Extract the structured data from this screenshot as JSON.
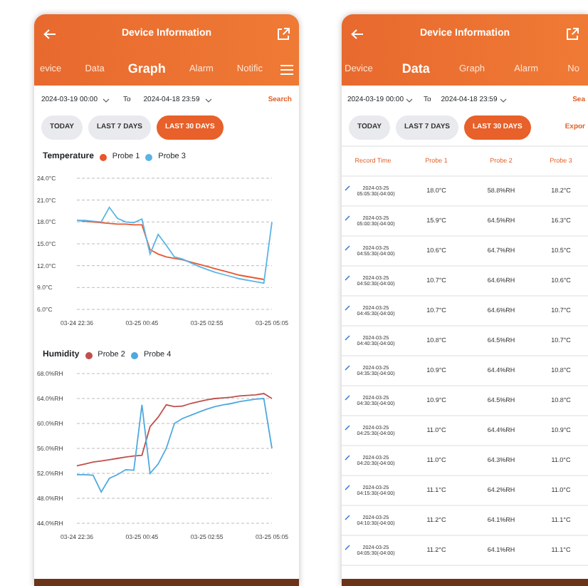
{
  "phones": [
    {
      "kind": "graph",
      "header": {
        "title": "Device Information",
        "tabs": [
          {
            "label": "evice",
            "selected": false
          },
          {
            "label": "Data",
            "selected": false
          },
          {
            "label": "Graph",
            "selected": true
          },
          {
            "label": "Alarm",
            "selected": false
          },
          {
            "label": "Notific",
            "selected": false
          }
        ]
      },
      "date_range": {
        "from": "2024-03-19 00:00",
        "to_label": "To",
        "to": "2024-04-18 23:59",
        "search": "Search"
      },
      "range_buttons": [
        {
          "label": "TODAY",
          "selected": false
        },
        {
          "label": "LAST 7 DAYS",
          "selected": false
        },
        {
          "label": "LAST 30 DAYS",
          "selected": true
        }
      ],
      "charts": [
        {
          "title": "Temperature",
          "chart_data": {
            "type": "line",
            "grid": true,
            "ylim": [
              6,
              24
            ],
            "yticks": [
              {
                "value": 24,
                "label": "24.0°C"
              },
              {
                "value": 21,
                "label": "21.0°C"
              },
              {
                "value": 18,
                "label": "18.0°C"
              },
              {
                "value": 15,
                "label": "15.0°C"
              },
              {
                "value": 12,
                "label": "12.0°C"
              },
              {
                "value": 9,
                "label": "9.0°C"
              },
              {
                "value": 6,
                "label": "6.0°C"
              }
            ],
            "categories": [
              "03-24 22:36",
              null,
              null,
              null,
              null,
              null,
              null,
              null,
              "03-25 00:45",
              null,
              null,
              null,
              null,
              null,
              null,
              null,
              "03-25 02:55",
              null,
              null,
              null,
              null,
              null,
              null,
              null,
              "03-25 05:05"
            ],
            "series": [
              {
                "name": "Probe 1",
                "color": "#e8562c",
                "values": [
                  18.2,
                  18.1,
                  18.0,
                  17.9,
                  17.8,
                  17.7,
                  17.7,
                  17.6,
                  17.6,
                  14.2,
                  13.6,
                  13.2,
                  13.0,
                  12.8,
                  12.5,
                  12.2,
                  11.9,
                  11.6,
                  11.3,
                  11.0,
                  10.7,
                  10.5,
                  10.3,
                  10.1,
                  null
                ]
              },
              {
                "name": "Probe 3",
                "color": "#5ab4e6",
                "values": [
                  18.2,
                  18.2,
                  18.1,
                  18.0,
                  20.0,
                  18.5,
                  18.0,
                  17.9,
                  18.4,
                  13.6,
                  16.3,
                  14.8,
                  13.2,
                  12.9,
                  12.4,
                  11.9,
                  11.5,
                  11.1,
                  10.8,
                  10.5,
                  10.2,
                  10.0,
                  9.8,
                  9.6,
                  18.0
                ]
              }
            ]
          }
        },
        {
          "title": "Humidity",
          "chart_data": {
            "type": "line",
            "grid": true,
            "ylim": [
              44,
              68
            ],
            "yticks": [
              {
                "value": 68,
                "label": "68.0%RH"
              },
              {
                "value": 64,
                "label": "64.0%RH"
              },
              {
                "value": 60,
                "label": "60.0%RH"
              },
              {
                "value": 56,
                "label": "56.0%RH"
              },
              {
                "value": 52,
                "label": "52.0%RH"
              },
              {
                "value": 48,
                "label": "48.0%RH"
              },
              {
                "value": 44,
                "label": "44.0%RH"
              }
            ],
            "categories": [
              "03-24 22:36",
              null,
              null,
              null,
              null,
              null,
              null,
              null,
              "03-25 00:45",
              null,
              null,
              null,
              null,
              null,
              null,
              null,
              "03-25 02:55",
              null,
              null,
              null,
              null,
              null,
              null,
              null,
              "03-25 05:05"
            ],
            "series": [
              {
                "name": "Probe 2",
                "color": "#c0504d",
                "values": [
                  53.2,
                  53.5,
                  53.8,
                  54.0,
                  54.2,
                  54.4,
                  54.6,
                  54.8,
                  54.9,
                  59.5,
                  61.0,
                  63.0,
                  62.7,
                  62.8,
                  63.2,
                  63.5,
                  63.8,
                  64.0,
                  64.1,
                  64.2,
                  64.4,
                  64.5,
                  64.6,
                  64.8,
                  64.0
                ]
              },
              {
                "name": "Probe 4",
                "color": "#4fa9e0",
                "values": [
                  51.8,
                  51.8,
                  51.7,
                  49.0,
                  51.2,
                  51.8,
                  52.6,
                  52.5,
                  63.0,
                  52.0,
                  53.5,
                  56.0,
                  60.0,
                  60.8,
                  61.3,
                  61.8,
                  62.3,
                  62.7,
                  63.0,
                  63.2,
                  63.5,
                  63.7,
                  63.9,
                  64.0,
                  56.0
                ]
              }
            ]
          }
        }
      ]
    },
    {
      "kind": "data",
      "header": {
        "title": "Device Information",
        "tabs": [
          {
            "label": "Device",
            "selected": false
          },
          {
            "label": "Data",
            "selected": true
          },
          {
            "label": "Graph",
            "selected": false
          },
          {
            "label": "Alarm",
            "selected": false
          },
          {
            "label": "No",
            "selected": false
          }
        ]
      },
      "date_range": {
        "from": "2024-03-19 00:00",
        "to_label": "To",
        "to": "2024-04-18 23:59",
        "search": "Sea"
      },
      "range_buttons": [
        {
          "label": "TODAY",
          "selected": false
        },
        {
          "label": "LAST 7 DAYS",
          "selected": false
        },
        {
          "label": "LAST 30 DAYS",
          "selected": true
        }
      ],
      "export": "Expor",
      "table": {
        "columns": [
          "Record Time",
          "Probe 1",
          "Probe 2",
          "Probe 3"
        ],
        "rows": [
          {
            "cells": [
              "2024-03-25 05:05:30(-04:00)",
              "18.0°C",
              "58.8%RH",
              "18.2°C"
            ]
          },
          {
            "cells": [
              "2024-03-25 05:00:30(-04:00)",
              "15.9°C",
              "64.5%RH",
              "16.3°C"
            ]
          },
          {
            "cells": [
              "2024-03-25 04:55:30(-04:00)",
              "10.6°C",
              "64.7%RH",
              "10.5°C"
            ]
          },
          {
            "cells": [
              "2024-03-25 04:50:30(-04:00)",
              "10.7°C",
              "64.6%RH",
              "10.6°C"
            ]
          },
          {
            "cells": [
              "2024-03-25 04:45:30(-04:00)",
              "10.7°C",
              "64.6%RH",
              "10.7°C"
            ]
          },
          {
            "cells": [
              "2024-03-25 04:40:30(-04:00)",
              "10.8°C",
              "64.5%RH",
              "10.7°C"
            ]
          },
          {
            "cells": [
              "2024-03-25 04:35:30(-04:00)",
              "10.9°C",
              "64.4%RH",
              "10.8°C"
            ]
          },
          {
            "cells": [
              "2024-03-25 04:30:30(-04:00)",
              "10.9°C",
              "64.5%RH",
              "10.8°C"
            ]
          },
          {
            "cells": [
              "2024-03-25 04:25:30(-04:00)",
              "11.0°C",
              "64.4%RH",
              "10.9°C"
            ]
          },
          {
            "cells": [
              "2024-03-25 04:20:30(-04:00)",
              "11.0°C",
              "64.3%RH",
              "11.0°C"
            ]
          },
          {
            "cells": [
              "2024-03-25 04:15:30(-04:00)",
              "11.1°C",
              "64.2%RH",
              "11.0°C"
            ]
          },
          {
            "cells": [
              "2024-03-25 04:10:30(-04:00)",
              "11.2°C",
              "64.1%RH",
              "11.1°C"
            ]
          },
          {
            "cells": [
              "2024-03-25 04:05:30(-04:00)",
              "11.2°C",
              "64.1%RH",
              "11.1°C"
            ]
          }
        ]
      }
    }
  ]
}
